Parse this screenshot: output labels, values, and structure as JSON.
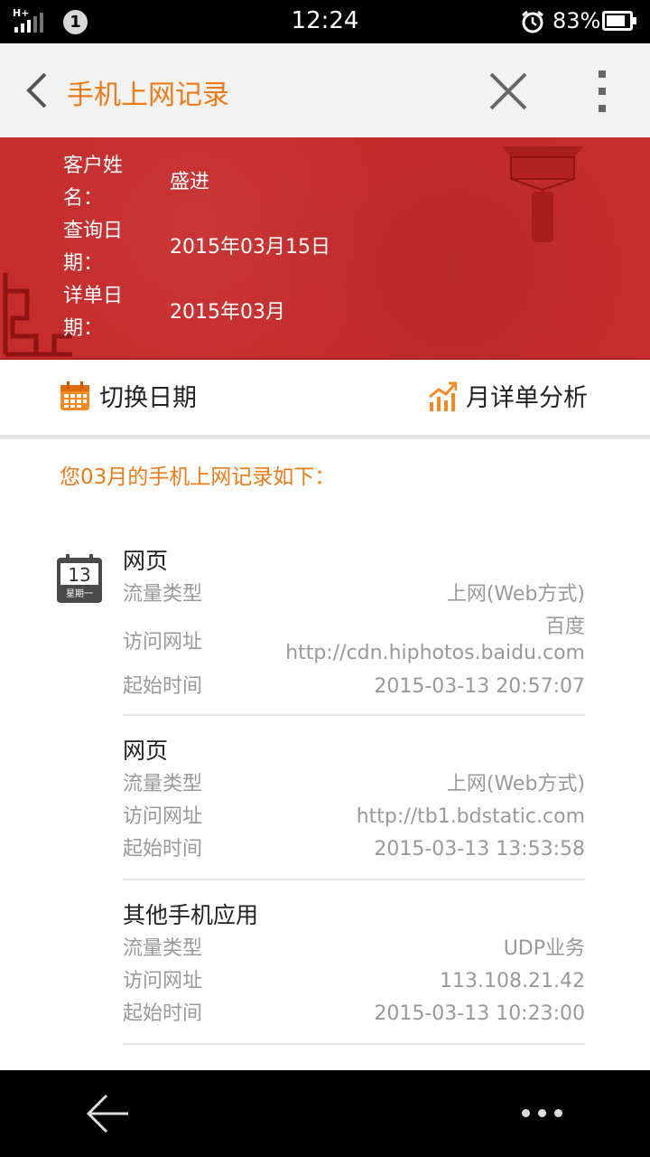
{
  "status_bar": {
    "network": "H+",
    "notification_count": "1",
    "time": "12:24",
    "battery_percent": "83%",
    "battery_level": 0.83
  },
  "header": {
    "title": "手机上网记录",
    "back_icon": "back-arrow-icon",
    "close_icon": "close-icon",
    "more_icon": "more-vertical-icon"
  },
  "customer": {
    "name_label": "客户姓名：",
    "name": "盛进",
    "query_date_label": "查询日期：",
    "query_date": "2015年03月15日",
    "bill_date_label": "详单日期：",
    "bill_date": "2015年03月"
  },
  "actions": {
    "switch_date": "切换日期",
    "monthly_analysis": "月详单分析"
  },
  "intro": "您03月的手机上网记录如下：",
  "calendar": {
    "day": "13",
    "weekday": "星期一"
  },
  "labels": {
    "type": "流量类型",
    "url": "访问网址",
    "start": "起始时间"
  },
  "records": [
    {
      "title": "网页",
      "type": "上网(Web方式)",
      "site_name": "百度",
      "url": "http://cdn.hiphotos.baidu.com",
      "start": "2015-03-13 20:57:07"
    },
    {
      "title": "网页",
      "type": "上网(Web方式)",
      "url": "http://tb1.bdstatic.com",
      "start": "2015-03-13 13:53:58"
    },
    {
      "title": "其他手机应用",
      "type": "UDP业务",
      "url": "113.108.21.42",
      "start": "2015-03-13 10:23:00"
    }
  ],
  "colors": {
    "accent": "#f07a16",
    "banner": "#c62c2c"
  }
}
